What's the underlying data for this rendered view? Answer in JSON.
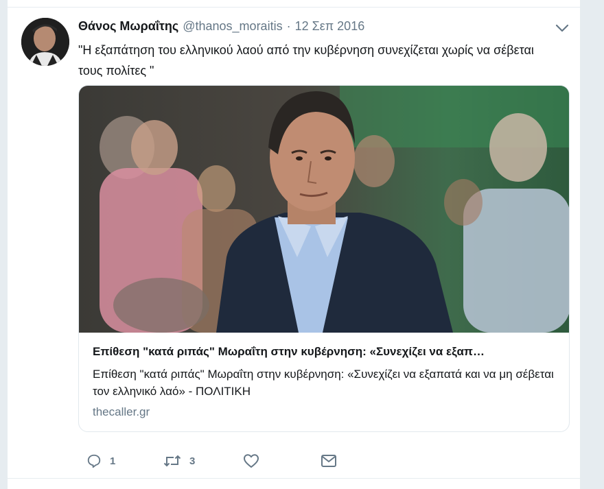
{
  "tweet": {
    "author": {
      "fullname": "Θάνος Μωραΐτης",
      "username": "@thanos_moraitis",
      "separator": "·",
      "timestamp": "12 Σεπ 2016",
      "avatar_icon": "avatar-photo"
    },
    "text": "\"Η εξαπάτηση του ελληνικού λαού από την κυβέρνηση συνεχίζεται χωρίς να σέβεται τους πολίτες \"",
    "card": {
      "image": "news-photo-man-in-crowd",
      "title": "Επίθεση \"κατά ριπάς\" Μωραΐτη στην κυβέρνηση: «Συνεχίζει να εξαπ…",
      "description": "Επίθεση \"κατά ριπάς\" Μωραΐτη στην κυβέρνηση: «Συνεχίζει να εξαπατά και να μη σέβεται τον ελληνικό λαό» - ΠΟΛΙΤΙΚΗ",
      "domain": "thecaller.gr"
    },
    "actions": {
      "reply": {
        "icon": "reply-icon",
        "count": "1"
      },
      "retweet": {
        "icon": "retweet-icon",
        "count": "3"
      },
      "like": {
        "icon": "heart-icon",
        "count": ""
      },
      "message": {
        "icon": "envelope-icon",
        "count": ""
      }
    }
  },
  "colors": {
    "background": "#e6ecf0",
    "text_primary": "#14171a",
    "text_secondary": "#657786",
    "card_border": "#e1e8ed"
  }
}
